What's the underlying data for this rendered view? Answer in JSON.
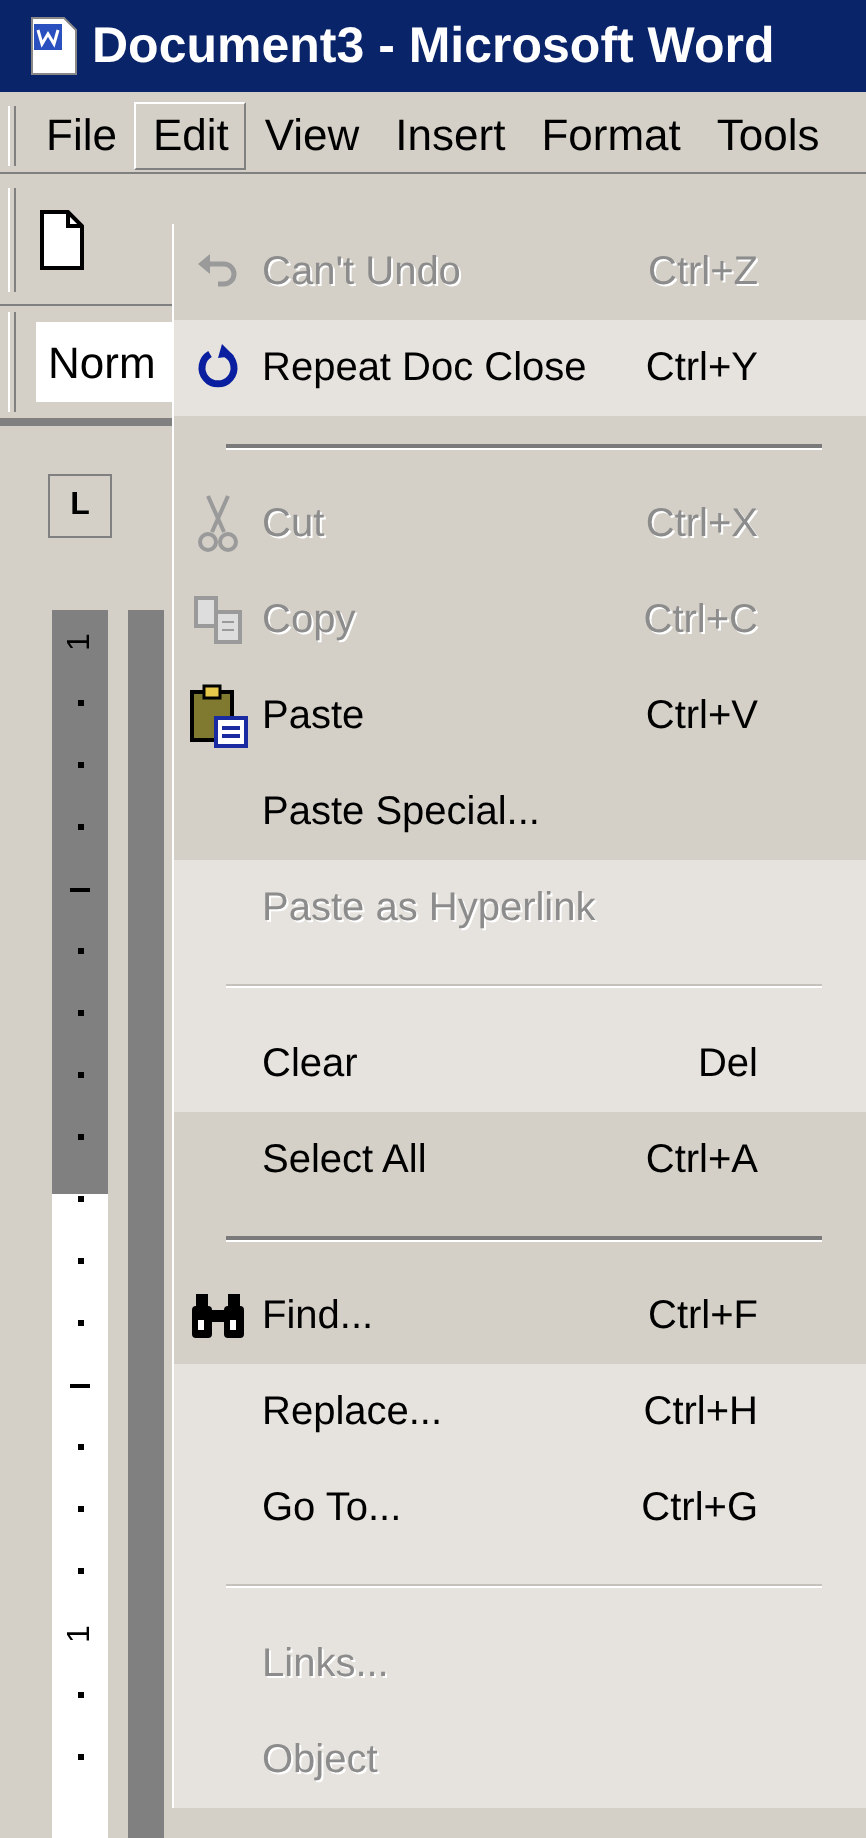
{
  "window": {
    "title": "Document3 - Microsoft Word"
  },
  "menu_bar": [
    {
      "label": "File",
      "selected": false
    },
    {
      "label": "Edit",
      "selected": true
    },
    {
      "label": "View",
      "selected": false
    },
    {
      "label": "Insert",
      "selected": false
    },
    {
      "label": "Format",
      "selected": false
    },
    {
      "label": "Tools",
      "selected": false
    }
  ],
  "style_box": {
    "value": "Norm"
  },
  "ruler": {
    "tab_selector": "L",
    "labels": [
      "1",
      "1"
    ]
  },
  "menu": {
    "items": [
      {
        "kind": "item",
        "label": "Can't Undo",
        "shortcut": "Ctrl+Z",
        "disabled": true,
        "recent": true
      },
      {
        "kind": "item",
        "label": "Repeat Doc Close",
        "shortcut": "Ctrl+Y",
        "disabled": false,
        "recent": false
      },
      {
        "kind": "separator",
        "recent": true
      },
      {
        "kind": "item",
        "label": "Cut",
        "shortcut": "Ctrl+X",
        "disabled": true,
        "recent": true
      },
      {
        "kind": "item",
        "label": "Copy",
        "shortcut": "Ctrl+C",
        "disabled": true,
        "recent": true
      },
      {
        "kind": "item",
        "label": "Paste",
        "shortcut": "Ctrl+V",
        "disabled": false,
        "recent": true
      },
      {
        "kind": "item",
        "label": "Paste Special...",
        "disabled": false,
        "recent": true
      },
      {
        "kind": "item",
        "label": "Paste as Hyperlink",
        "disabled": true,
        "recent": false
      },
      {
        "kind": "separator",
        "recent": false
      },
      {
        "kind": "item",
        "label": "Clear",
        "shortcut": "Del",
        "disabled": false,
        "recent": false
      },
      {
        "kind": "item",
        "label": "Select All",
        "shortcut": "Ctrl+A",
        "disabled": false,
        "recent": true
      },
      {
        "kind": "separator",
        "recent": true
      },
      {
        "kind": "item",
        "label": "Find...",
        "shortcut": "Ctrl+F",
        "disabled": false,
        "recent": true
      },
      {
        "kind": "item",
        "label": "Replace...",
        "shortcut": "Ctrl+H",
        "disabled": false,
        "recent": false
      },
      {
        "kind": "item",
        "label": "Go To...",
        "shortcut": "Ctrl+G",
        "disabled": false,
        "recent": false
      },
      {
        "kind": "separator",
        "recent": false
      },
      {
        "kind": "item",
        "label": "Links...",
        "disabled": true,
        "recent": false
      },
      {
        "kind": "item",
        "label": "Object",
        "disabled": true,
        "recent": false
      }
    ]
  }
}
